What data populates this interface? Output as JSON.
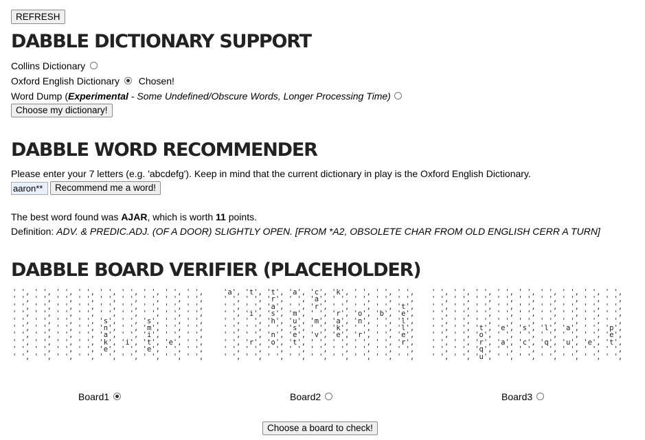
{
  "refresh_label": "REFRESH",
  "dictionary_section": {
    "title": "DABBLE DICTIONARY SUPPORT",
    "options": [
      {
        "label": "Collins Dictionary",
        "selected": false
      },
      {
        "label": "Oxford English Dictionary",
        "selected": true,
        "status": "Chosen!"
      },
      {
        "label_prefix": "Word Dump (",
        "label_bold": "Experimental",
        "label_rest": " - Some Undefined/Obscure Words, Longer Processing Time)",
        "selected": false
      }
    ],
    "choose_button": "Choose my dictionary!"
  },
  "recommender_section": {
    "title": "DABBLE WORD RECOMMENDER",
    "instructions": "Please enter your 7 letters (e.g. 'abcdefg'). Keep in mind that the current dictionary in play is the Oxford English Dictionary.",
    "input_value": "aaron**",
    "recommend_button": "Recommend me a word!",
    "result_prefix": "The best word found was ",
    "result_word": "AJAR",
    "result_mid": ", which is worth ",
    "result_points": "11",
    "result_suffix": " points.",
    "definition_label": "Definition: ",
    "definition_text": "ADV. & PREDIC.ADJ. (OF A DOOR) SLIGHTLY OPEN. [FROM *A2, OBSOLETE CHAR FROM OLD ENGLISH CERR A TURN]"
  },
  "verifier_section": {
    "title": "DABBLE BOARD VERIFIER (PLACEHOLDER)",
    "boards": [
      {
        "label": "Board1",
        "selected": true,
        "rows": [
          "' ', ' ', ' ', ' ', ' ', ' ', ' ', ' ', ' ',",
          "' ', ' ', ' ', ' ', ' ', ' ', ' ', ' ', ' ',",
          "' ', ' ', ' ', ' ', ' ', ' ', ' ', ' ', ' ',",
          "' ', ' ', ' ', ' ', ' ', ' ', ' ', ' ', ' ',",
          "' ', ' ', ' ', ' ', 's', ' ', 's', ' ', ' ',",
          "' ', ' ', ' ', ' ', 'n', ' ', 'm', ' ', ' ',",
          "' ', ' ', ' ', ' ', 'a', ' ', 'i', ' ', ' ',",
          "' ', ' ', ' ', ' ', 'k', 'i', 't', 'e', ' ',",
          "' ', ' ', ' ', ' ', 'e', ' ', 'e', ' ', ' ',",
          "' ', ' ', ' ', ' ', ' ', ' ', ' ', ' ', ' ',"
        ]
      },
      {
        "label": "Board2",
        "selected": false,
        "rows": [
          "'a', 't', 't', 'a', 'c', 'k', ' ', ' ', ' ',",
          "' ', ' ', 'r', ' ', 'a', ' ', ' ', ' ', ' ',",
          "' ', ' ', 'a', ' ', 'r', ' ', ' ', ' ', 't',",
          "' ', 'i', 's', 'm', ' ', 'r', 'o', 'b', 'e',",
          "' ', ' ', 'h', 'u', 'm', 'a', 'n', ' ', 'l',",
          "' ', ' ', ' ', 's', ' ', 'k', ' ', ' ', 'l',",
          "' ', ' ', 'n', 'e', 'v', 'e', 'r', ' ', 'e',",
          "' ', 'r', 'o', 't', ' ', ' ', ' ', ' ', 'r',",
          "' ', ' ', ' ', ' ', ' ', ' ', ' ', ' ', ' ',",
          "' ', ' ', ' ', ' ', ' ', ' ', ' ', ' ', ' ',"
        ]
      },
      {
        "label": "Board3",
        "selected": false,
        "rows": [
          "' ', ' ', ' ', ' ', ' ', ' ', ' ', ' ', ' ',",
          "' ', ' ', ' ', ' ', ' ', ' ', ' ', ' ', ' ',",
          "' ', ' ', ' ', ' ', ' ', ' ', ' ', ' ', ' ',",
          "' ', ' ', ' ', ' ', ' ', ' ', ' ', ' ', ' ',",
          "' ', ' ', ' ', ' ', ' ', ' ', ' ', ' ', ' ',",
          "' ', ' ', 't', 'e', 's', 'l', 'a', ' ', 'p',",
          "' ', ' ', 'o', ' ', ' ', ' ', ' ', ' ', 'e',",
          "' ', ' ', 'r', 'a', 'c', 'q', 'u', 'e', 't',",
          "' ', ' ', 'q', ' ', ' ', ' ', ' ', ' ', ' ',",
          "' ', ' ', 'u', ' ', ' ', ' ', ' ', ' ', ' ',"
        ]
      }
    ],
    "check_button": "Choose a board to check!"
  }
}
